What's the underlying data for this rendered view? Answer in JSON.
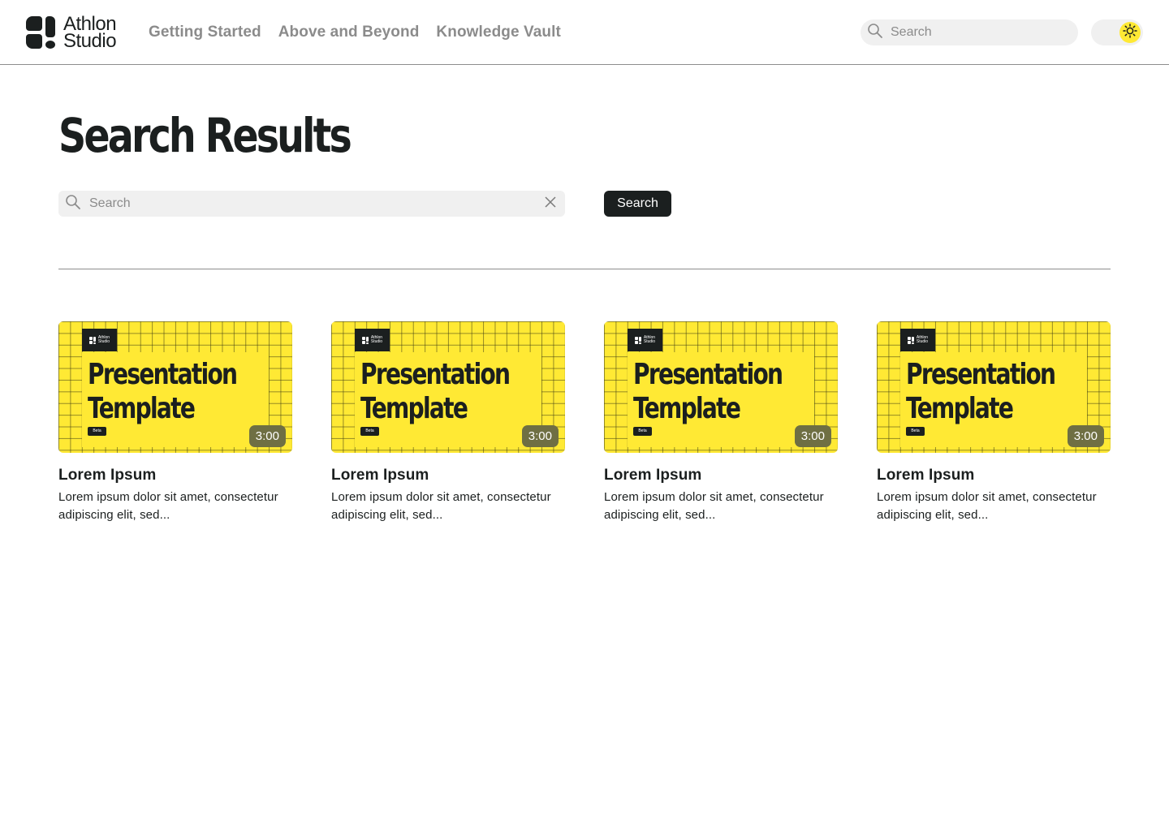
{
  "header": {
    "logo": {
      "line1": "Athlon",
      "line2": "Studio"
    },
    "nav": [
      {
        "label": "Getting Started"
      },
      {
        "label": "Above and Beyond"
      },
      {
        "label": "Knowledge Vault"
      }
    ],
    "search": {
      "placeholder": "Search",
      "icon": "search-icon"
    },
    "theme_toggle": {
      "icon": "sun-icon",
      "state": "light"
    }
  },
  "main": {
    "title": "Search Results",
    "search": {
      "placeholder": "Search",
      "value": "",
      "clear_icon": "close-icon"
    },
    "search_button": "Search"
  },
  "results": [
    {
      "thumbnail": {
        "brand_line1": "Athlon",
        "brand_line2": "Studio",
        "title_line1": "Presentation",
        "title_line2": "Template",
        "tag": "Beta",
        "duration": "3:00"
      },
      "title": "Lorem Ipsum",
      "description": "Lorem ipsum dolor sit amet, consectetur adipiscing elit, sed..."
    },
    {
      "thumbnail": {
        "brand_line1": "Athlon",
        "brand_line2": "Studio",
        "title_line1": "Presentation",
        "title_line2": "Template",
        "tag": "Beta",
        "duration": "3:00"
      },
      "title": "Lorem Ipsum",
      "description": "Lorem ipsum dolor sit amet, consectetur adipiscing elit, sed..."
    },
    {
      "thumbnail": {
        "brand_line1": "Athlon",
        "brand_line2": "Studio",
        "title_line1": "Presentation",
        "title_line2": "Template",
        "tag": "Beta",
        "duration": "3:00"
      },
      "title": "Lorem Ipsum",
      "description": "Lorem ipsum dolor sit amet, consectetur adipiscing elit, sed..."
    },
    {
      "thumbnail": {
        "brand_line1": "Athlon",
        "brand_line2": "Studio",
        "title_line1": "Presentation",
        "title_line2": "Template",
        "tag": "Beta",
        "duration": "3:00"
      },
      "title": "Lorem Ipsum",
      "description": "Lorem ipsum dolor sit amet, consectetur adipiscing elit, sed..."
    }
  ],
  "colors": {
    "accent_yellow": "#ffe934",
    "ink": "#1b1f1f",
    "muted_text": "#8b8b8b",
    "field_bg": "#f0f0f0",
    "duration_badge": "#6f6f43"
  }
}
